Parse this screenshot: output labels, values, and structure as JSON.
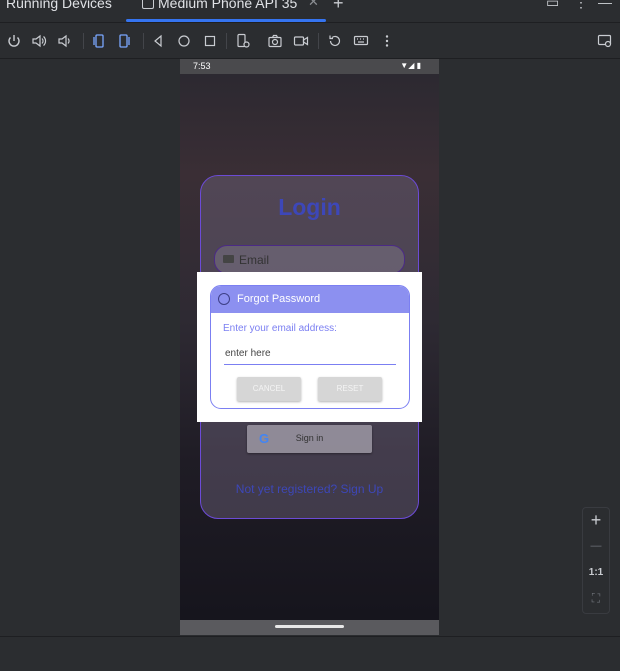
{
  "header": {
    "panel_title": "Running Devices",
    "tab_label": "Medium Phone API 35",
    "tab_close": "✕",
    "tab_add": "+",
    "window_icons": [
      "▭",
      "⋮",
      "—"
    ]
  },
  "toolbar": {
    "icons": [
      "power-icon",
      "volume-up-icon",
      "volume-down-icon",
      "rotate-left-icon",
      "rotate-right-icon",
      "back-icon",
      "home-icon",
      "overview-icon",
      "device-settings-icon",
      "screenshot-icon",
      "screen-record-icon",
      "reset-icon",
      "keyboard-icon",
      "more-options-icon",
      "device-mirroring-icon"
    ]
  },
  "phone": {
    "status_time": "7:53",
    "status_icons": "▼◢ ▮"
  },
  "login": {
    "title": "Login",
    "email_label": "Email",
    "google_label": "Sign in",
    "google_g": "G",
    "signup_link": "Not yet registered? Sign Up"
  },
  "dialog": {
    "title": "Forgot Password",
    "prompt": "Enter your email address:",
    "placeholder": "enter here",
    "cancel_label": "CANCEL",
    "reset_label": "RESET"
  },
  "zoom": {
    "in": "+",
    "out": "—",
    "actual": "1:1",
    "fit": "⛶"
  },
  "colors": {
    "accent": "#3574f0",
    "dialog_header": "#8c90f0",
    "login_title": "#3d47b8",
    "card_border": "#6c4bd6"
  }
}
